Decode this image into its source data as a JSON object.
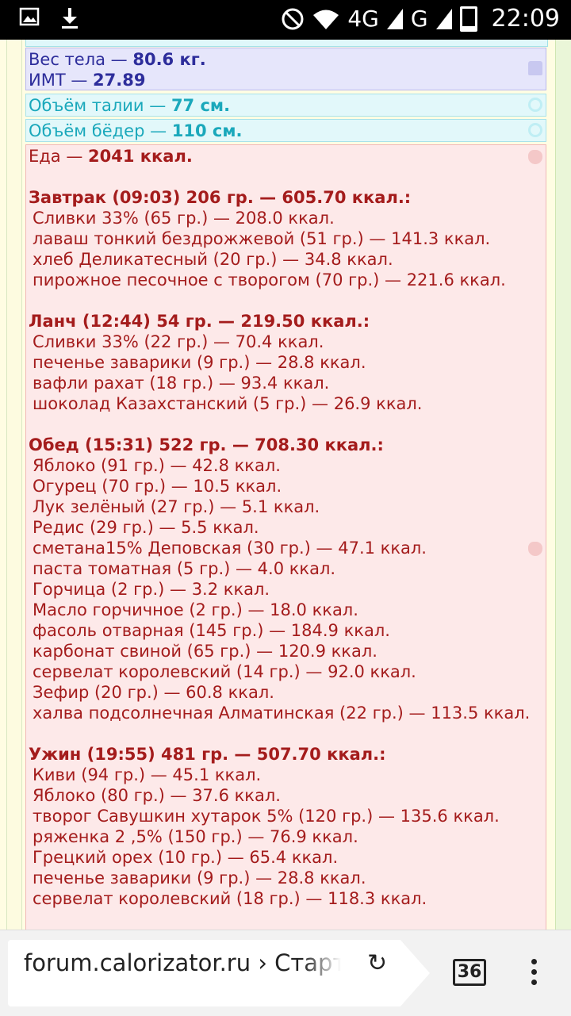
{
  "status": {
    "network": "4G",
    "network2": "G",
    "time": "22:09",
    "icons": [
      "image-icon",
      "download-icon",
      "do-not-disturb-icon",
      "wifi-icon",
      "signal-icon",
      "battery-icon"
    ]
  },
  "weight": {
    "line1": "Вес тела — ",
    "value1": "80.6 кг.",
    "line2": "ИМТ — ",
    "value2": "27.89"
  },
  "waist": {
    "label": "Объём талии — ",
    "value": "77 см."
  },
  "hips": {
    "label": "Объём бёдер — ",
    "value": "110 см."
  },
  "food": {
    "label": "Еда — ",
    "value": "2041 ккал.",
    "meals": [
      {
        "title": "Завтрак (09:03) 206 гр. — 605.70 ккал.:",
        "items": [
          "Сливки 33% (65 гр.) — 208.0 ккал.",
          "лаваш тонкий бездрожжевой (51 гр.) — 141.3 ккал.",
          "хлеб Деликатесный (20 гр.) — 34.8 ккал.",
          "пирожное песочное с творогом (70 гр.) — 221.6 ккал."
        ]
      },
      {
        "title": "Ланч (12:44) 54 гр. — 219.50 ккал.:",
        "items": [
          "Сливки 33% (22 гр.) — 70.4 ккал.",
          "печенье заварики (9 гр.) — 28.8 ккал.",
          "вафли рахат (18 гр.) — 93.4 ккал.",
          "шоколад Казахстанский (5 гр.) — 26.9 ккал."
        ]
      },
      {
        "title": "Обед (15:31) 522 гр. — 708.30 ккал.:",
        "items": [
          "Яблоко (91 гр.) — 42.8 ккал.",
          "Огурец (70 гр.) — 10.5 ккал.",
          "Лук зелёный (27 гр.) — 5.1 ккал.",
          "Редис (29 гр.) — 5.5 ккал.",
          "сметана15% Деповская (30 гр.) — 47.1 ккал.",
          "паста томатная (5 гр.) — 4.0 ккал.",
          "Горчица (2 гр.) — 3.2 ккал.",
          "Масло горчичное (2 гр.) — 18.0 ккал.",
          "фасоль отварная (145 гр.) — 184.9 ккал.",
          "карбонат свиной (65 гр.) — 120.9 ккал.",
          "сервелат королевский (14 гр.) — 92.0 ккал.",
          "Зефир (20 гр.) — 60.8 ккал.",
          "халва подсолнечная Алматинская (22 гр.) — 113.5 ккал."
        ]
      },
      {
        "title": "Ужин (19:55) 481 гр. — 507.70 ккал.:",
        "items": [
          "Киви (94 гр.) — 45.1 ккал.",
          "Яблоко (80 гр.) — 37.6 ккал.",
          "творог Савушкин хутарок 5% (120 гр.) — 135.6 ккал.",
          "ряженка 2 ,5% (150 гр.) — 76.9 ккал.",
          "Грецкий орех (10 гр.) — 65.4 ккал.",
          "печенье заварики (9 гр.) — 28.8 ккал.",
          "сервелат королевский (18 гр.) — 118.3 ккал."
        ]
      }
    ]
  },
  "browser": {
    "url": "forum.calorizator.ru › Стартовая",
    "tab_count": "36",
    "icons": [
      "reload-icon",
      "tabs-icon",
      "menu-icon"
    ]
  }
}
